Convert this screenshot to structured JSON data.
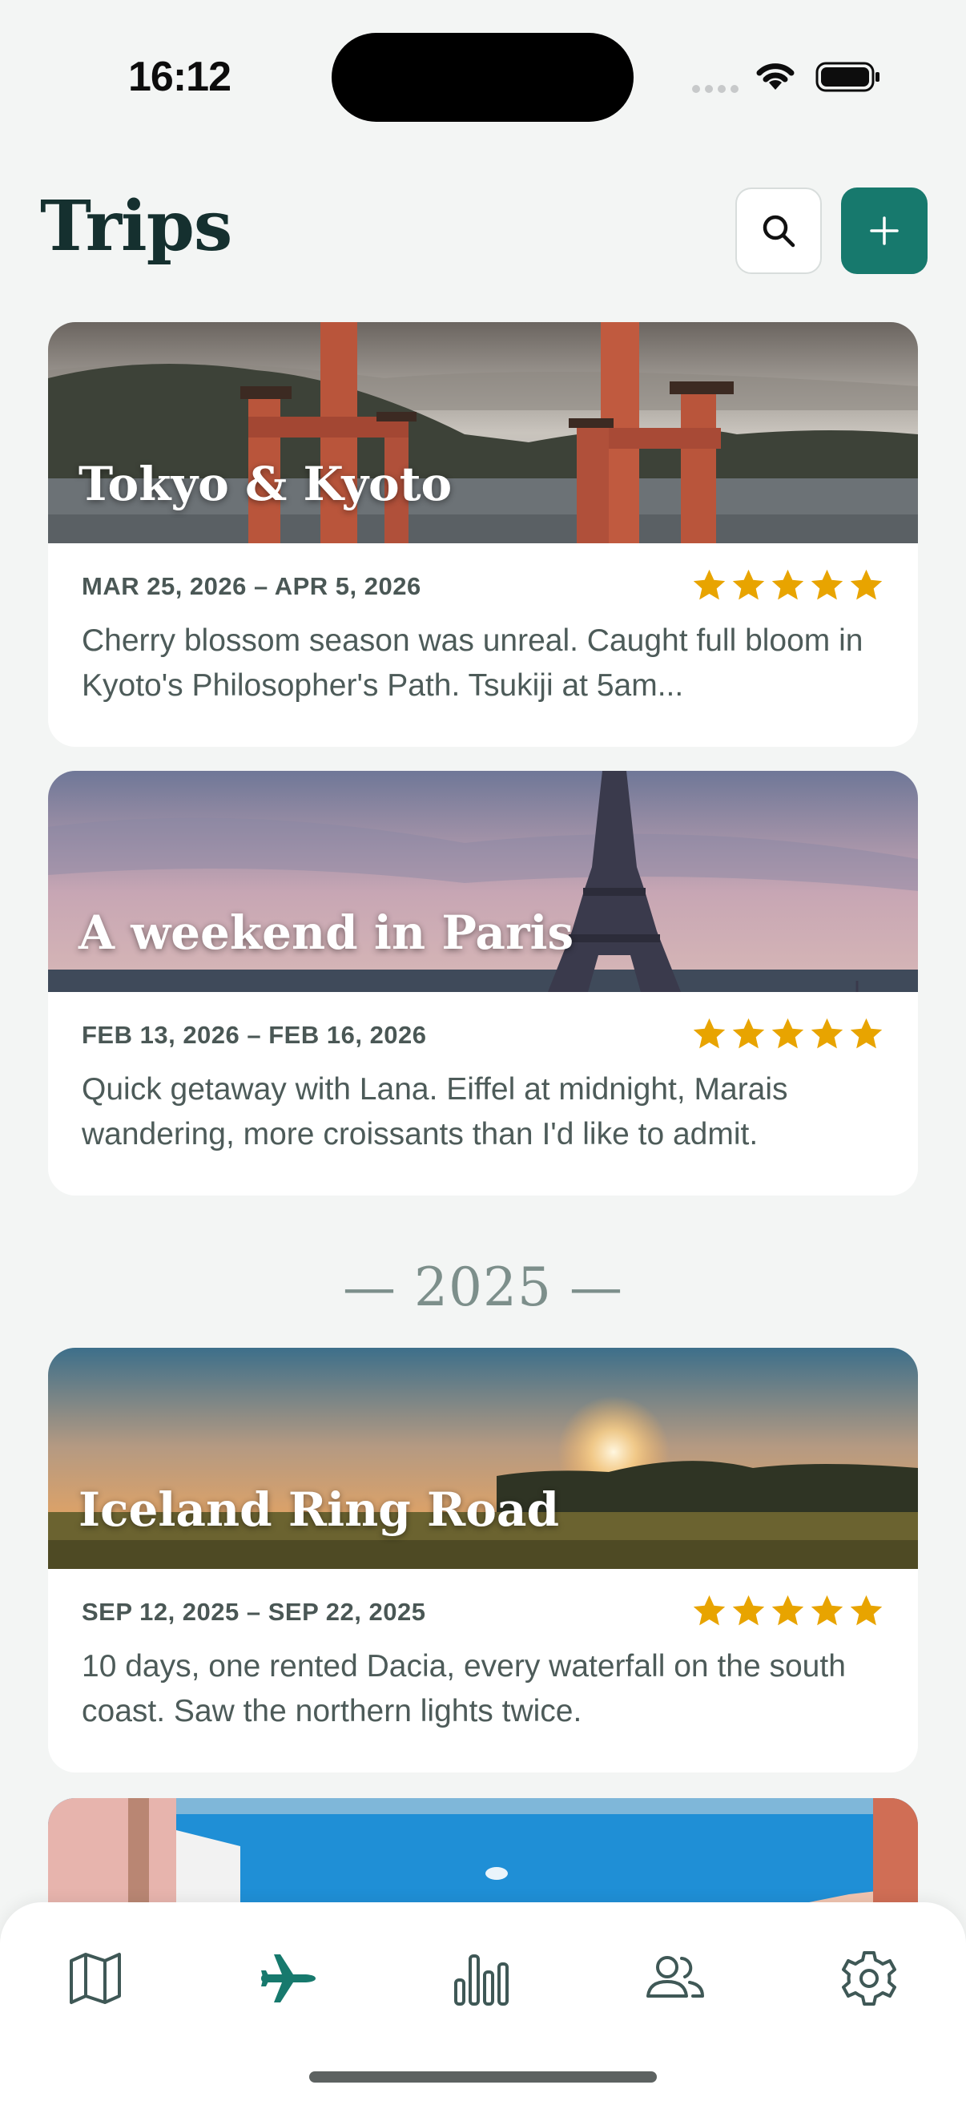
{
  "status_bar": {
    "time": "16:12"
  },
  "header": {
    "title": "Trips"
  },
  "trips": [
    {
      "title": "Tokyo & Kyoto",
      "dates": "MAR 25, 2026 – APR 5, 2026",
      "rating": 5,
      "notes": "Cherry blossom season was unreal. Caught full bloom in Kyoto's Philosopher's Path. Tsukiji at 5am..."
    },
    {
      "title": "A weekend in Paris",
      "dates": "FEB 13, 2026 – FEB 16, 2026",
      "rating": 5,
      "notes": "Quick getaway with Lana. Eiffel at midnight, Marais wandering, more croissants than I'd like to admit."
    },
    {
      "title": "Iceland Ring Road",
      "dates": "SEP 12, 2025 – SEP 22, 2025",
      "rating": 5,
      "notes": "10 days, one rented Dacia, every waterfall on the south coast. Saw the northern lights twice."
    }
  ],
  "year_divider": "— 2025 —",
  "colors": {
    "accent": "#17796d",
    "star": "#e8a400",
    "background": "#f3f5f4"
  },
  "tabs": [
    {
      "icon": "map-icon",
      "active": false
    },
    {
      "icon": "airplane-icon",
      "active": true
    },
    {
      "icon": "bar-chart-icon",
      "active": false
    },
    {
      "icon": "people-icon",
      "active": false
    },
    {
      "icon": "settings-gear-icon",
      "active": false
    }
  ]
}
